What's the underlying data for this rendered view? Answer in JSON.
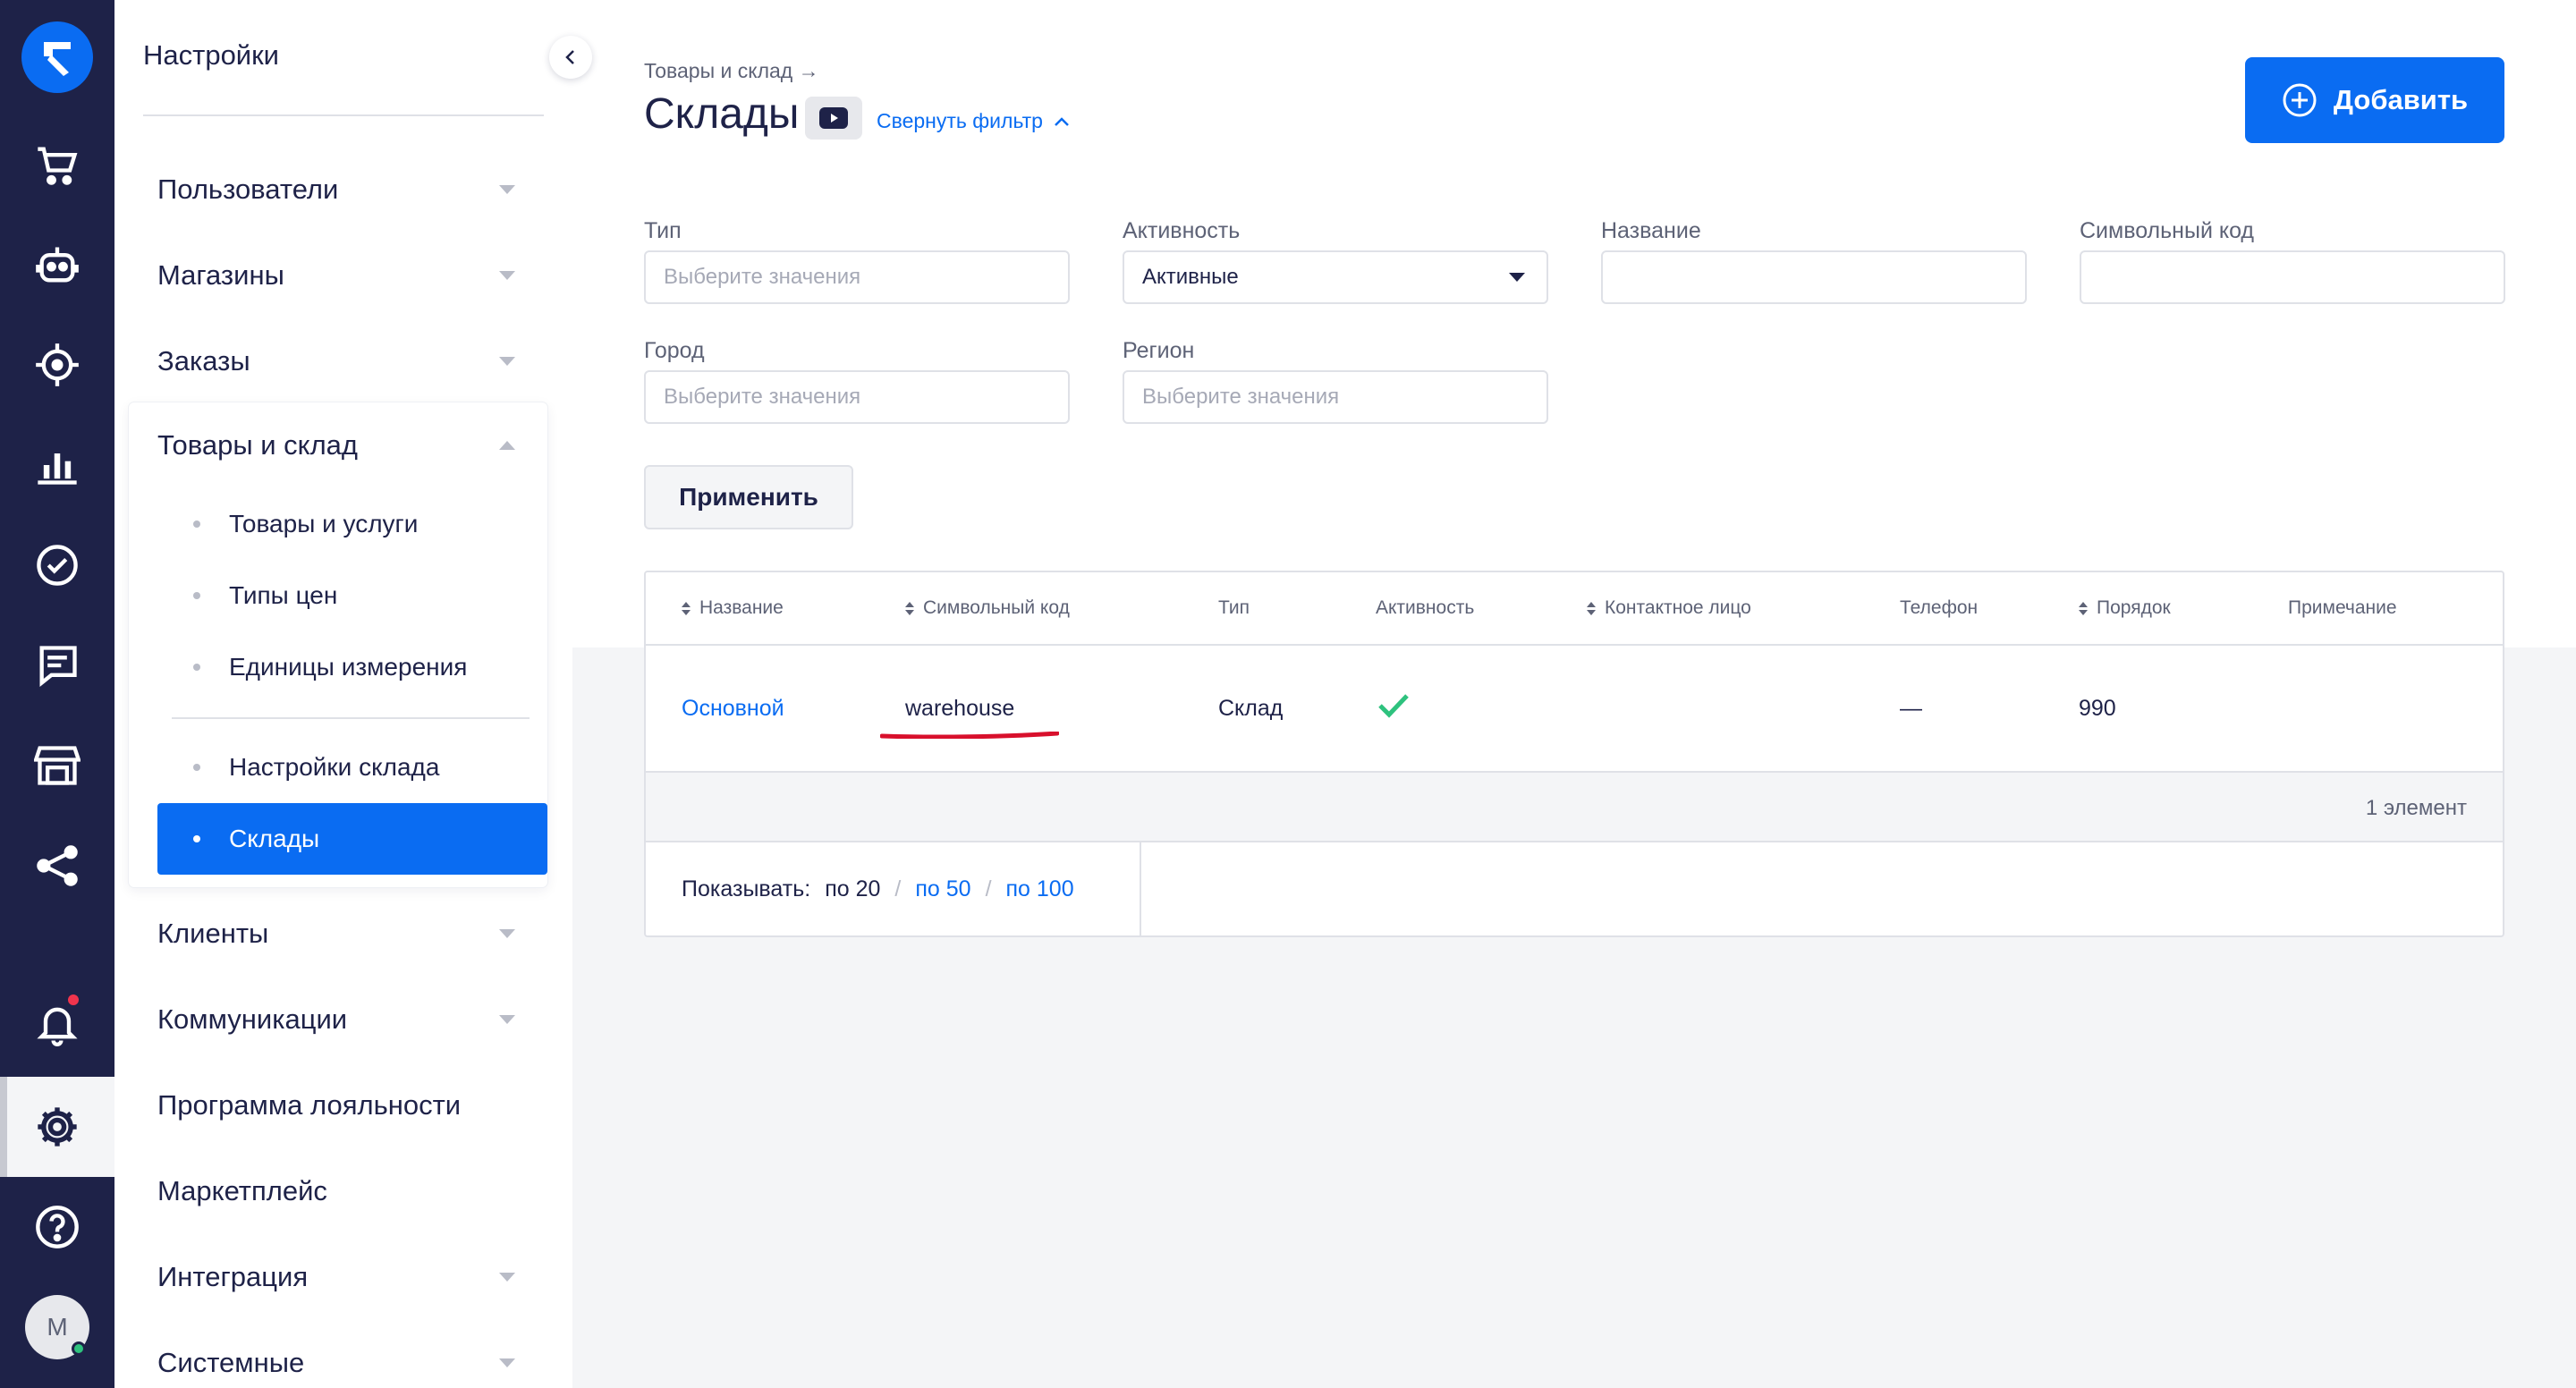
{
  "colors": {
    "rail": "#1e2248",
    "accent": "#0a6cf2",
    "check": "#2ec27e",
    "mark": "#d8102c"
  },
  "rail": {
    "icons": [
      "logo-icon",
      "cart-icon",
      "robot-icon",
      "target-icon",
      "analytics-icon",
      "task-check-icon",
      "chat-icon",
      "store-icon",
      "share-icon",
      "bell-icon",
      "gear-icon",
      "help-icon"
    ],
    "avatar_initial": "M"
  },
  "sidebar": {
    "title": "Настройки",
    "items": [
      {
        "label": "Пользователи"
      },
      {
        "label": "Магазины"
      },
      {
        "label": "Заказы"
      },
      {
        "label": "Товары и склад"
      },
      {
        "label": "Клиенты"
      },
      {
        "label": "Коммуникации"
      },
      {
        "label": "Программа лояльности"
      },
      {
        "label": "Маркетплейс"
      },
      {
        "label": "Интеграция"
      },
      {
        "label": "Системные"
      }
    ],
    "subitems": [
      {
        "label": "Товары и услуги"
      },
      {
        "label": "Типы цен"
      },
      {
        "label": "Единицы измерения"
      },
      {
        "label": "Настройки склада"
      },
      {
        "label": "Склады"
      }
    ]
  },
  "header": {
    "breadcrumb": "Товары и склад →",
    "title": "Склады",
    "filter_toggle": "Свернуть фильтр",
    "add_label": "Добавить"
  },
  "filters": {
    "type": {
      "label": "Тип",
      "placeholder": "Выберите значения"
    },
    "activity": {
      "label": "Активность",
      "value": "Активные"
    },
    "name": {
      "label": "Название"
    },
    "code": {
      "label": "Символьный код"
    },
    "city": {
      "label": "Город",
      "placeholder": "Выберите значения"
    },
    "region": {
      "label": "Регион",
      "placeholder": "Выберите значения"
    },
    "apply_label": "Применить"
  },
  "table": {
    "columns": [
      "Название",
      "Символьный код",
      "Тип",
      "Активность",
      "Контактное лицо",
      "Телефон",
      "Порядок",
      "Примечание"
    ],
    "rows": [
      {
        "name": "Основной",
        "code": "warehouse",
        "type": "Склад",
        "active": true,
        "contact": "",
        "phone": "—",
        "order": "990",
        "note": ""
      }
    ],
    "count_text": "1 элемент",
    "pager": {
      "label": "Показывать:",
      "current": "по 20",
      "opt1": "по 50",
      "opt2": "по 100"
    }
  }
}
